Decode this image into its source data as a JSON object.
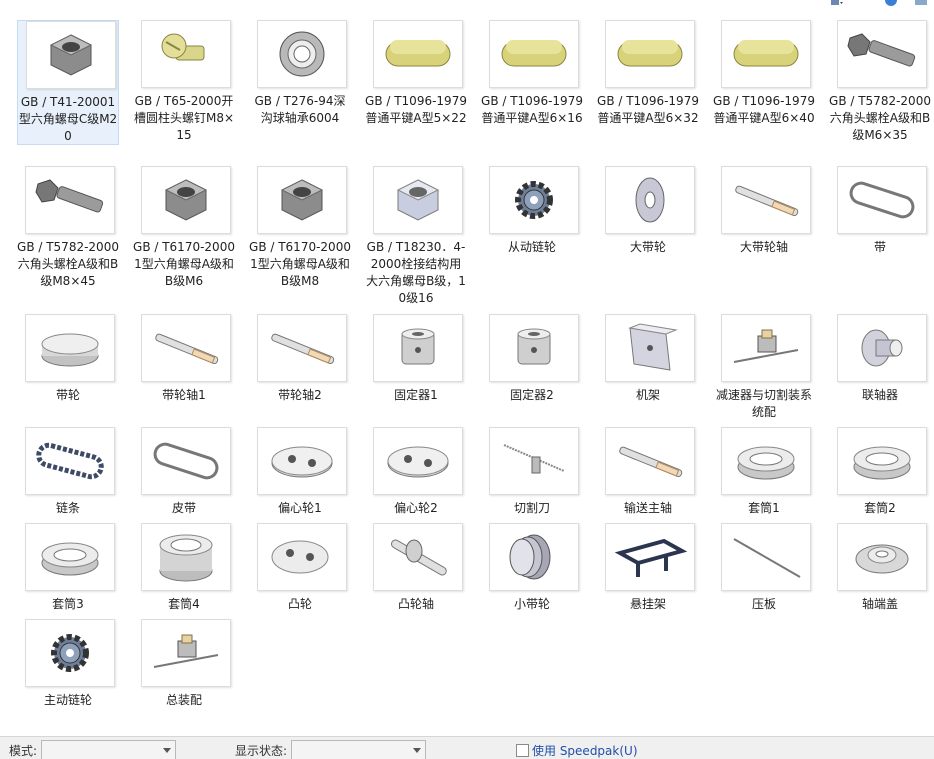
{
  "items": [
    {
      "label": "GB / T41-20001型六角螺母C级M20",
      "icon": "hex-nut-icon",
      "selected": true
    },
    {
      "label": "GB / T65-2000开槽圆柱头螺钉M8×15",
      "icon": "slotted-screw-icon"
    },
    {
      "label": "GB / T276-94深沟球轴承6004",
      "icon": "ball-bearing-icon"
    },
    {
      "label": "GB / T1096-1979普通平键A型5×22",
      "icon": "flat-key-icon"
    },
    {
      "label": "GB / T1096-1979普通平键A型6×16",
      "icon": "flat-key-icon"
    },
    {
      "label": "GB / T1096-1979普通平键A型6×32",
      "icon": "flat-key-icon"
    },
    {
      "label": "GB / T1096-1979普通平键A型6×40",
      "icon": "flat-key-icon"
    },
    {
      "label": "GB / T5782-2000六角头螺栓A级和B级M6×35",
      "icon": "hex-bolt-icon"
    },
    {
      "label": "GB / T5782-2000六角头螺栓A级和B级M8×45",
      "icon": "hex-bolt-icon"
    },
    {
      "label": "GB / T6170-20001型六角螺母A级和B级M6",
      "icon": "hex-nut-icon"
    },
    {
      "label": "GB / T6170-20001型六角螺母A级和B级M8",
      "icon": "hex-nut-icon"
    },
    {
      "label": "GB / T18230．4-2000栓接结构用大六角螺母B级，10级16",
      "icon": "large-hex-nut-icon"
    },
    {
      "label": "从动链轮",
      "icon": "sprocket-icon"
    },
    {
      "label": "大带轮",
      "icon": "pulley-icon"
    },
    {
      "label": "大带轮轴",
      "icon": "shaft-icon"
    },
    {
      "label": "带",
      "icon": "belt-icon"
    },
    {
      "label": "带轮",
      "icon": "disc-icon"
    },
    {
      "label": "带轮轴1",
      "icon": "shaft-icon"
    },
    {
      "label": "带轮轴2",
      "icon": "shaft-icon"
    },
    {
      "label": "固定器1",
      "icon": "bushing-icon"
    },
    {
      "label": "固定器2",
      "icon": "bushing-icon"
    },
    {
      "label": "机架",
      "icon": "frame-plate-icon"
    },
    {
      "label": "减速器与切割装系统配",
      "icon": "assembly-icon"
    },
    {
      "label": "联轴器",
      "icon": "coupling-icon"
    },
    {
      "label": "链条",
      "icon": "chain-icon"
    },
    {
      "label": "皮带",
      "icon": "belt-icon"
    },
    {
      "label": "偏心轮1",
      "icon": "eccentric-wheel-icon"
    },
    {
      "label": "偏心轮2",
      "icon": "eccentric-wheel-icon"
    },
    {
      "label": "切割刀",
      "icon": "cutter-blade-icon"
    },
    {
      "label": "输送主轴",
      "icon": "shaft-icon"
    },
    {
      "label": "套筒1",
      "icon": "ring-icon"
    },
    {
      "label": "套筒2",
      "icon": "ring-icon"
    },
    {
      "label": "套筒3",
      "icon": "ring-icon"
    },
    {
      "label": "套筒4",
      "icon": "sleeve-icon"
    },
    {
      "label": "凸轮",
      "icon": "cam-icon"
    },
    {
      "label": "凸轮轴",
      "icon": "camshaft-icon"
    },
    {
      "label": "小带轮",
      "icon": "grooved-pulley-icon"
    },
    {
      "label": "悬挂架",
      "icon": "hanger-frame-icon"
    },
    {
      "label": "压板",
      "icon": "press-rod-icon"
    },
    {
      "label": "轴端盖",
      "icon": "end-cap-icon"
    },
    {
      "label": "主动链轮",
      "icon": "sprocket-icon"
    },
    {
      "label": "总装配",
      "icon": "assembly-icon"
    }
  ],
  "statusbar": {
    "mode_label": "模式:",
    "mode_value": "",
    "display_state_label": "显示状态:",
    "display_state_value": "",
    "speedpak_label": "使用 Speedpak(U)",
    "speedpak_checked": false
  },
  "colors": {
    "selected_bg": "#e8f1fb",
    "link": "#1f4fa8",
    "key_yellow": "#d8d27a",
    "metal": "#a8a8a8",
    "statusbar_bg": "#f0f0f0"
  }
}
